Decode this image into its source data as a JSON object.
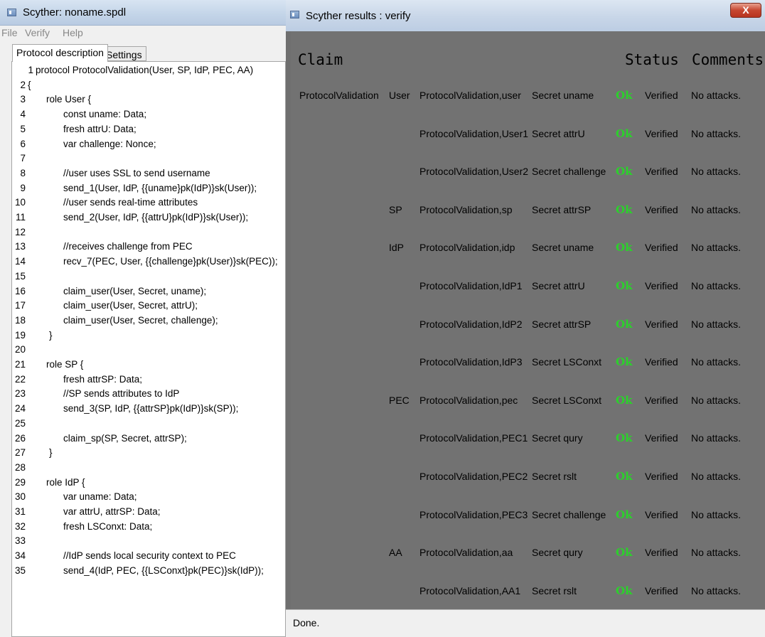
{
  "left_window": {
    "title": "Scyther: noname.spdl",
    "menu": [
      "File",
      "Verify",
      "Help"
    ],
    "tabs": [
      "Protocol description",
      "Settings"
    ],
    "code_lines": [
      {
        "no": "1",
        "code": "protocol ProtocolValidation(User, SP, IdP, PEC, AA)"
      },
      {
        "no": "2",
        "code": "{"
      },
      {
        "no": "3",
        "code": "role User {"
      },
      {
        "no": "4",
        "code": "const uname: Data;"
      },
      {
        "no": "5",
        "code": "fresh attrU: Data;"
      },
      {
        "no": "6",
        "code": "var challenge: Nonce;"
      },
      {
        "no": "7",
        "code": ""
      },
      {
        "no": "8",
        "code": "//user uses SSL to send username"
      },
      {
        "no": "9",
        "code": "send_1(User, IdP, {{uname}pk(IdP)}sk(User));"
      },
      {
        "no": "10",
        "code": "//user sends real-time attributes"
      },
      {
        "no": "11",
        "code": "send_2(User, IdP, {{attrU}pk(IdP)}sk(User));"
      },
      {
        "no": "12",
        "code": ""
      },
      {
        "no": "13",
        "code": "//receives challenge from PEC"
      },
      {
        "no": "14",
        "code": "recv_7(PEC, User, {{challenge}pk(User)}sk(PEC));"
      },
      {
        "no": "15",
        "code": ""
      },
      {
        "no": "16",
        "code": "claim_user(User, Secret, uname);"
      },
      {
        "no": "17",
        "code": "claim_user(User, Secret, attrU);"
      },
      {
        "no": "18",
        "code": "claim_user(User, Secret, challenge);"
      },
      {
        "no": "19",
        "code": "}"
      },
      {
        "no": "20",
        "code": ""
      },
      {
        "no": "21",
        "code": "role SP {"
      },
      {
        "no": "22",
        "code": "fresh attrSP: Data;"
      },
      {
        "no": "23",
        "code": "//SP sends attributes to IdP"
      },
      {
        "no": "24",
        "code": "send_3(SP, IdP,  {{attrSP}pk(IdP)}sk(SP));"
      },
      {
        "no": "25",
        "code": ""
      },
      {
        "no": "26",
        "code": "claim_sp(SP, Secret, attrSP);"
      },
      {
        "no": "27",
        "code": "}"
      },
      {
        "no": "28",
        "code": ""
      },
      {
        "no": "29",
        "code": "role IdP {"
      },
      {
        "no": "30",
        "code": "var uname: Data;"
      },
      {
        "no": "31",
        "code": "var attrU, attrSP: Data;"
      },
      {
        "no": "32",
        "code": "fresh LSConxt: Data;"
      },
      {
        "no": "33",
        "code": ""
      },
      {
        "no": "34",
        "code": "//IdP sends local security context to PEC"
      },
      {
        "no": "35",
        "code": "send_4(IdP, PEC, {{LSConxt}pk(PEC)}sk(IdP));"
      }
    ]
  },
  "right_window": {
    "title": "Scyther results : verify",
    "close_label": "X",
    "headers": {
      "claim": "Claim",
      "status": "Status",
      "comments": "Comments"
    },
    "rows": [
      {
        "protocol": "ProtocolValidation",
        "role": "User",
        "label": "ProtocolValidation,user",
        "claim": "Secret uname",
        "status": "Ok",
        "verdict": "Verified",
        "comment": "No attacks."
      },
      {
        "protocol": "",
        "role": "",
        "label": "ProtocolValidation,User1",
        "claim": "Secret attrU",
        "status": "Ok",
        "verdict": "Verified",
        "comment": "No attacks."
      },
      {
        "protocol": "",
        "role": "",
        "label": "ProtocolValidation,User2",
        "claim": "Secret challenge",
        "status": "Ok",
        "verdict": "Verified",
        "comment": "No attacks."
      },
      {
        "protocol": "",
        "role": "SP",
        "label": "ProtocolValidation,sp",
        "claim": "Secret attrSP",
        "status": "Ok",
        "verdict": "Verified",
        "comment": "No attacks."
      },
      {
        "protocol": "",
        "role": "IdP",
        "label": "ProtocolValidation,idp",
        "claim": "Secret uname",
        "status": "Ok",
        "verdict": "Verified",
        "comment": "No attacks."
      },
      {
        "protocol": "",
        "role": "",
        "label": "ProtocolValidation,IdP1",
        "claim": "Secret attrU",
        "status": "Ok",
        "verdict": "Verified",
        "comment": "No attacks."
      },
      {
        "protocol": "",
        "role": "",
        "label": "ProtocolValidation,IdP2",
        "claim": "Secret attrSP",
        "status": "Ok",
        "verdict": "Verified",
        "comment": "No attacks."
      },
      {
        "protocol": "",
        "role": "",
        "label": "ProtocolValidation,IdP3",
        "claim": "Secret LSConxt",
        "status": "Ok",
        "verdict": "Verified",
        "comment": "No attacks."
      },
      {
        "protocol": "",
        "role": "PEC",
        "label": "ProtocolValidation,pec",
        "claim": "Secret LSConxt",
        "status": "Ok",
        "verdict": "Verified",
        "comment": "No attacks."
      },
      {
        "protocol": "",
        "role": "",
        "label": "ProtocolValidation,PEC1",
        "claim": "Secret qury",
        "status": "Ok",
        "verdict": "Verified",
        "comment": "No attacks."
      },
      {
        "protocol": "",
        "role": "",
        "label": "ProtocolValidation,PEC2",
        "claim": "Secret rslt",
        "status": "Ok",
        "verdict": "Verified",
        "comment": "No attacks."
      },
      {
        "protocol": "",
        "role": "",
        "label": "ProtocolValidation,PEC3",
        "claim": "Secret challenge",
        "status": "Ok",
        "verdict": "Verified",
        "comment": "No attacks."
      },
      {
        "protocol": "",
        "role": "AA",
        "label": "ProtocolValidation,aa",
        "claim": "Secret qury",
        "status": "Ok",
        "verdict": "Verified",
        "comment": "No attacks."
      },
      {
        "protocol": "",
        "role": "",
        "label": "ProtocolValidation,AA1",
        "claim": "Secret rslt",
        "status": "Ok",
        "verdict": "Verified",
        "comment": "No attacks."
      }
    ],
    "status_bar": "Done."
  },
  "colors": {
    "ok_green": "#2bd12b",
    "results_background": "#727272",
    "close_red": "#c64630"
  }
}
